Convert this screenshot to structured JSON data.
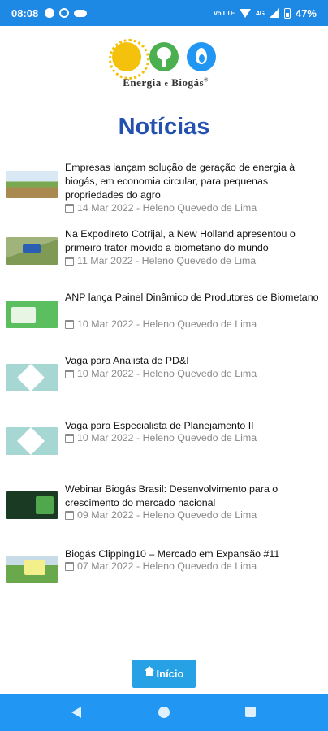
{
  "status_bar": {
    "time": "08:08",
    "network_label": "Vo LTE",
    "signal_label": "4G",
    "battery": "47%"
  },
  "logo": {
    "brand_prefix": "Energia",
    "brand_connector": "e",
    "brand_suffix": "Biogás",
    "trademark": "®"
  },
  "page": {
    "title": "Notícias"
  },
  "news": [
    {
      "title": "Empresas lançam solução de geração de energia à biogás, em economia circular, para pequenas propriedades do agro",
      "meta": "14 Mar 2022 - Heleno Quevedo de Lima"
    },
    {
      "title": "Na Expodireto Cotrijal, a New Holland apresentou o primeiro trator movido a biometano do mundo",
      "meta": "11 Mar 2022 - Heleno Quevedo de Lima"
    },
    {
      "title": "ANP lança Painel Dinâmico de Produtores de Biometano",
      "meta": "10 Mar 2022 - Heleno Quevedo de Lima"
    },
    {
      "title": "Vaga para Analista de PD&I",
      "meta": "10 Mar 2022 - Heleno Quevedo de Lima"
    },
    {
      "title": "Vaga para Especialista de Planejamento II",
      "meta": "10 Mar 2022 - Heleno Quevedo de Lima"
    },
    {
      "title": "Webinar Biogás Brasil: Desenvolvimento para o crescimento do mercado nacional",
      "meta": "09 Mar 2022 - Heleno Quevedo de Lima"
    },
    {
      "title": "Biogás Clipping10 – Mercado em Expansão #11",
      "meta": "07 Mar 2022 - Heleno Quevedo de Lima"
    }
  ],
  "footer": {
    "home_label": "Início"
  },
  "icons": {
    "calendar": "calendar-icon",
    "home": "home-icon",
    "back": "back-icon",
    "recents": "recents-icon"
  },
  "colors": {
    "status_bar": "#1e88e5",
    "title": "#2450b0",
    "button": "#27a1e6",
    "nav_bar": "#2196f3",
    "meta_text": "#8a8a8a"
  }
}
